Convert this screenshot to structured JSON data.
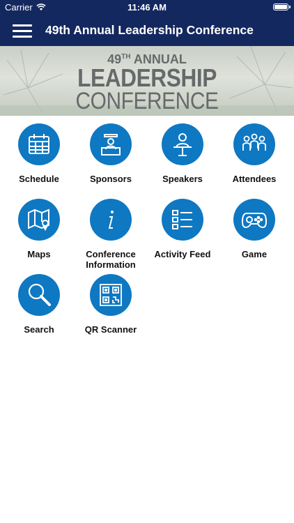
{
  "status_bar": {
    "carrier": "Carrier",
    "time": "11:46 AM"
  },
  "navbar": {
    "title": "49th Annual Leadership Conference",
    "menu_icon": "hamburger-icon"
  },
  "banner": {
    "line1": "49",
    "line1_sup": "TH",
    "line1_rest": " ANNUAL",
    "line2": "LEADERSHIP",
    "line3": "CONFERENCE"
  },
  "colors": {
    "header": "#13285f",
    "icon_circle": "#0e78c2"
  },
  "tiles": [
    {
      "label": "Schedule",
      "icon": "calendar-icon"
    },
    {
      "label": "Sponsors",
      "icon": "podium-icon"
    },
    {
      "label": "Speakers",
      "icon": "speaker-icon"
    },
    {
      "label": "Attendees",
      "icon": "people-icon"
    },
    {
      "label": "Maps",
      "icon": "map-icon"
    },
    {
      "label": "Conference\nInformation",
      "icon": "info-icon"
    },
    {
      "label": "Activity Feed",
      "icon": "list-icon"
    },
    {
      "label": "Game",
      "icon": "gamepad-icon"
    },
    {
      "label": "Search",
      "icon": "search-icon"
    },
    {
      "label": "QR Scanner",
      "icon": "qr-code-icon"
    }
  ]
}
